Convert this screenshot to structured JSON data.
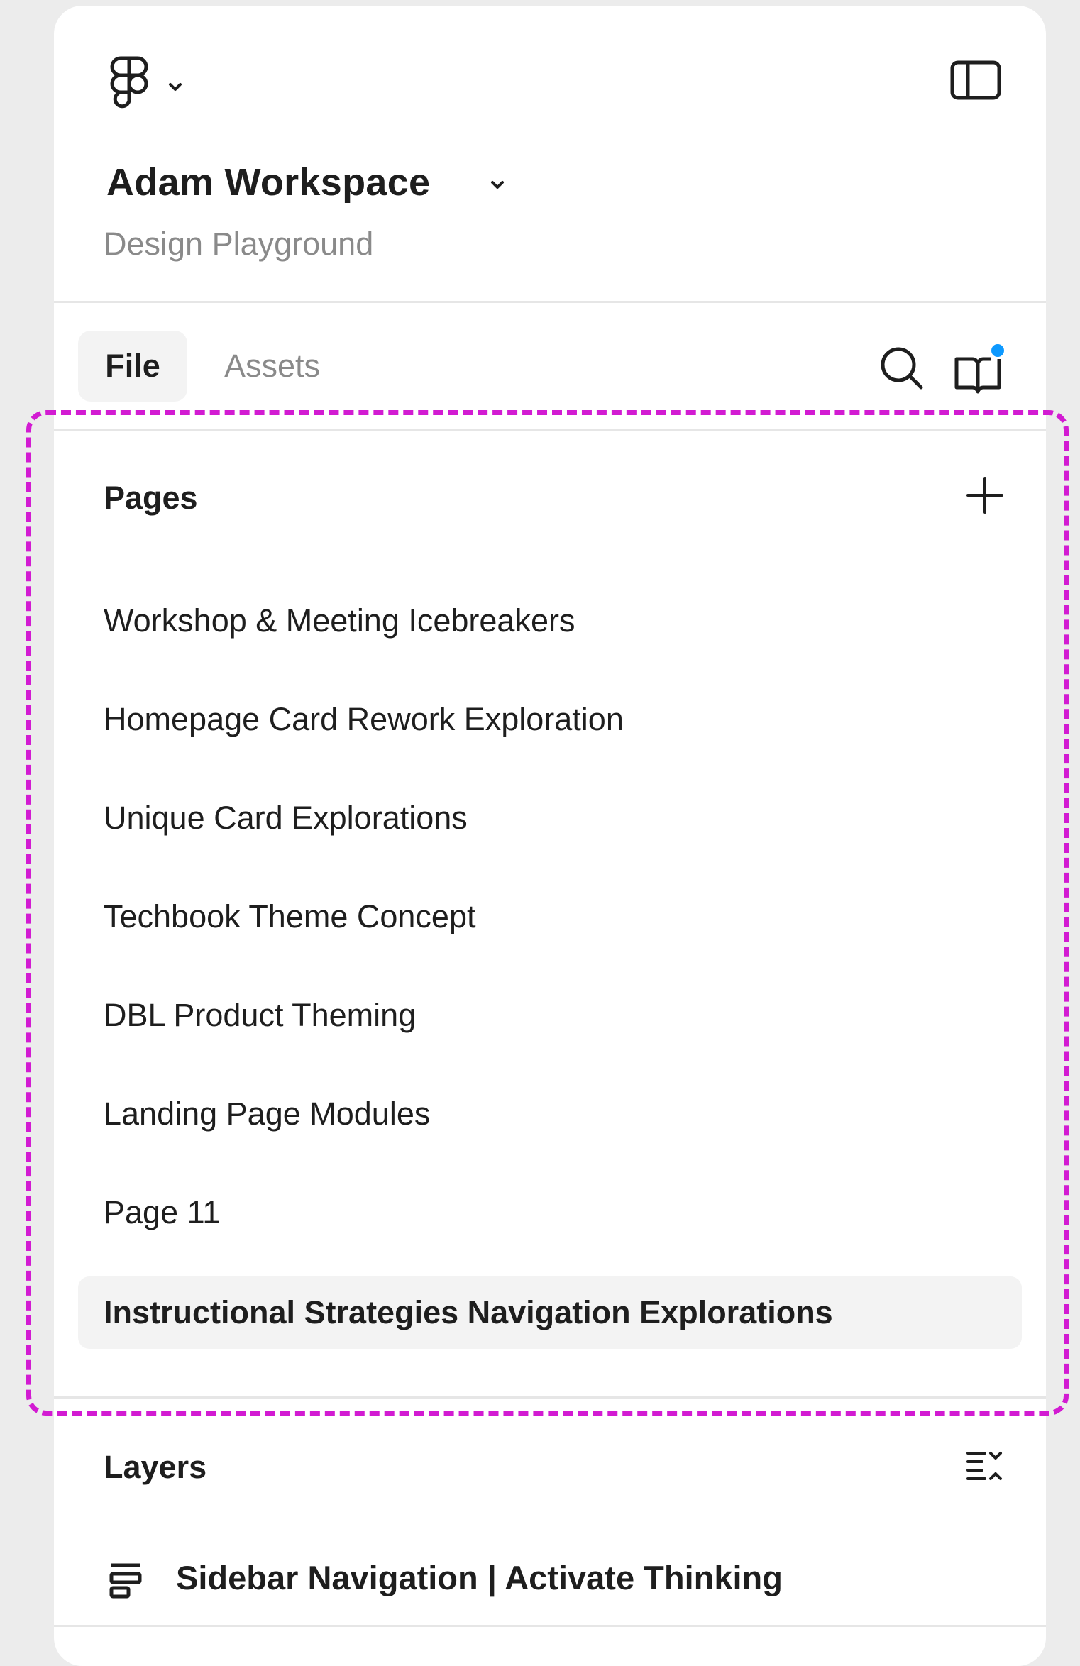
{
  "header": {
    "workspace_name": "Adam Workspace",
    "project_name": "Design Playground",
    "logo_icon": "figma-logo-icon",
    "menu_icon": "chevron-down-icon",
    "panel_toggle_icon": "sidebar-toggle-icon"
  },
  "tabs": [
    {
      "label": "File",
      "active": true
    },
    {
      "label": "Assets",
      "active": false
    }
  ],
  "toolbar": {
    "search_icon": "search-icon",
    "library_icon": "library-book-icon",
    "library_has_notification": true,
    "notification_color": "#0d99ff"
  },
  "pages": {
    "label": "Pages",
    "add_icon": "plus-icon",
    "items": [
      {
        "label": "Workshop & Meeting Icebreakers",
        "active": false
      },
      {
        "label": "Homepage Card Rework Exploration",
        "active": false
      },
      {
        "label": "Unique Card Explorations",
        "active": false
      },
      {
        "label": "Techbook Theme Concept",
        "active": false
      },
      {
        "label": "DBL Product Theming",
        "active": false
      },
      {
        "label": "Landing Page Modules",
        "active": false
      },
      {
        "label": "Page 11",
        "active": false
      },
      {
        "label": "Instructional Strategies Navigation Explorations",
        "active": true
      }
    ]
  },
  "layers": {
    "label": "Layers",
    "collapse_icon": "collapse-layers-icon",
    "items": [
      {
        "label": "Sidebar Navigation | Activate Thinking",
        "icon": "frame-layout-icon"
      }
    ]
  },
  "annotation": {
    "highlight_color": "#d21bd2"
  }
}
